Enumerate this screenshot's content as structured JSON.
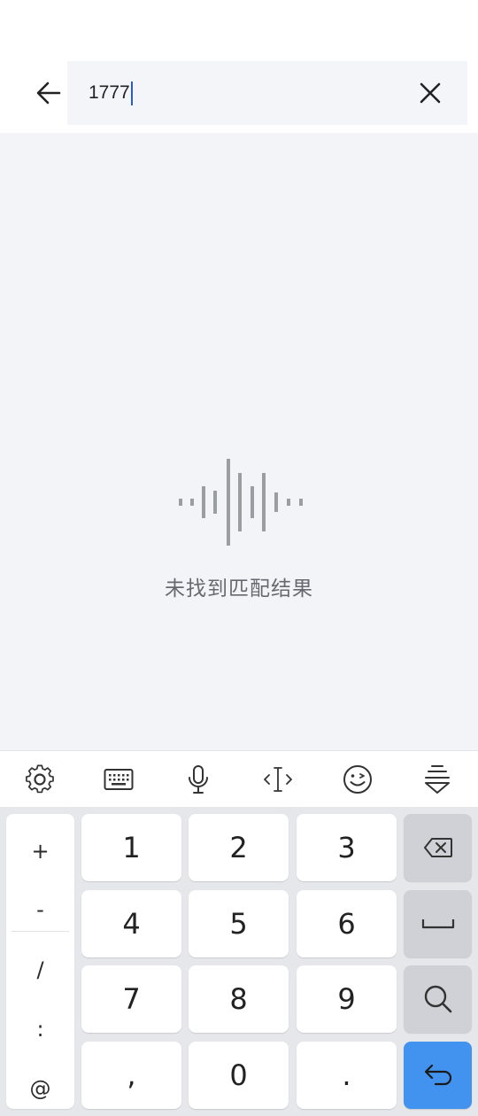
{
  "search": {
    "value": "1777"
  },
  "empty_state": {
    "message": "未找到匹配结果"
  },
  "toolbar": {
    "items": [
      "settings-icon",
      "keyboard-icon",
      "microphone-icon",
      "cursor-move-icon",
      "emoji-icon",
      "hide-keyboard-icon"
    ]
  },
  "keyboard": {
    "symbols": [
      "+",
      "-",
      "/",
      ":",
      "@"
    ],
    "keys": [
      "1",
      "2",
      "3",
      "4",
      "5",
      "6",
      "7",
      "8",
      "9",
      ",",
      "0",
      "."
    ],
    "function_keys": [
      "backspace-icon",
      "space-icon",
      "search-icon",
      "enter-icon"
    ]
  },
  "colors": {
    "accent": "#4293ef",
    "caret": "#2d5ebf",
    "background": "#f3f4f7"
  }
}
